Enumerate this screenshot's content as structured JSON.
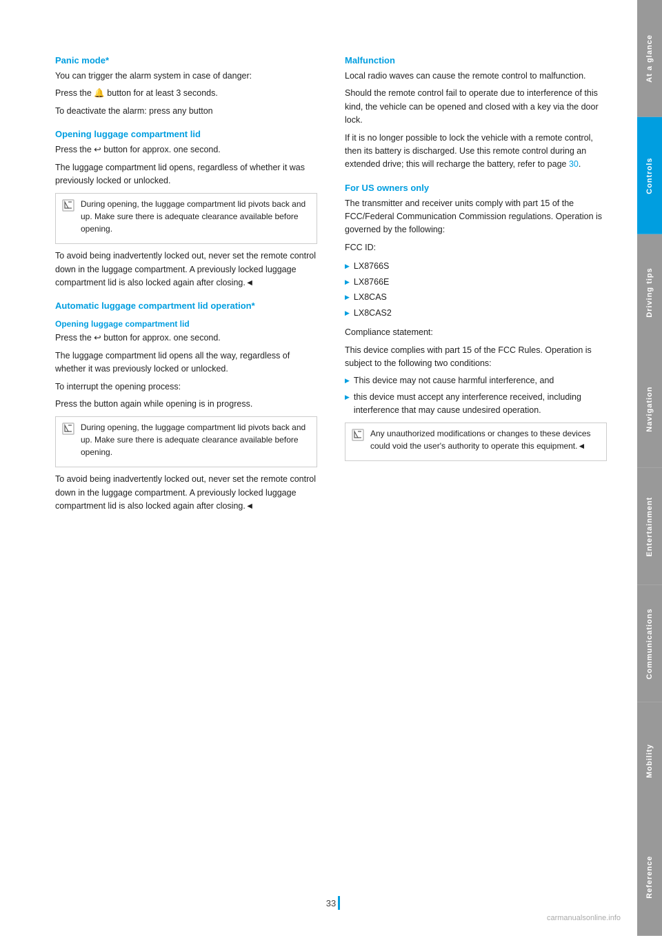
{
  "sidebar": {
    "tabs": [
      {
        "label": "At a glance",
        "key": "at-glance"
      },
      {
        "label": "Controls",
        "key": "controls"
      },
      {
        "label": "Driving tips",
        "key": "driving-tips"
      },
      {
        "label": "Navigation",
        "key": "navigation"
      },
      {
        "label": "Entertainment",
        "key": "entertainment"
      },
      {
        "label": "Communications",
        "key": "communications"
      },
      {
        "label": "Mobility",
        "key": "mobility"
      },
      {
        "label": "Reference",
        "key": "reference"
      }
    ]
  },
  "left_column": {
    "panic_mode": {
      "heading": "Panic mode*",
      "text1": "You can trigger the alarm system in case of danger:",
      "text2": "Press the 🔔 button for at least 3 seconds.",
      "text3": "To deactivate the alarm: press any button"
    },
    "opening_lid": {
      "heading": "Opening luggage compartment lid",
      "text1": "Press the ↩ button for approx. one second.",
      "text2": "The luggage compartment lid opens, regardless of whether it was previously locked or unlocked.",
      "note1": "During opening, the luggage compartment lid pivots back and up. Make sure there is adequate clearance available before opening.",
      "text3": "To avoid being inadvertently locked out, never set the remote control down in the luggage compartment. A previously locked luggage compartment lid is also locked again after closing.◄"
    },
    "auto_lid": {
      "heading": "Automatic luggage compartment lid operation*",
      "sub_heading": "Opening luggage compartment lid",
      "text1": "Press the ↩ button for approx. one second.",
      "text2": "The luggage compartment lid opens all the way, regardless of whether it was previously locked or unlocked.",
      "text3": "To interrupt the opening process:",
      "text4": "Press the button again while opening is in progress.",
      "note1": "During opening, the luggage compartment lid pivots back and up. Make sure there is adequate clearance available before opening.",
      "text5": "To avoid being inadvertently locked out, never set the remote control down in the luggage compartment. A previously locked luggage compartment lid is also locked again after closing.◄"
    }
  },
  "right_column": {
    "malfunction": {
      "heading": "Malfunction",
      "text1": "Local radio waves can cause the remote control to malfunction.",
      "text2": "Should the remote control fail to operate due to interference of this kind, the vehicle can be opened and closed with a key via the door lock.",
      "text3": "If it is no longer possible to lock the vehicle with a remote control, then its battery is discharged. Use this remote control during an extended drive; this will recharge the battery, refer to page 30."
    },
    "for_us_owners": {
      "heading": "For US owners only",
      "text1": "The transmitter and receiver units comply with part 15 of the FCC/Federal Communication Commission regulations. Operation is governed by the following:",
      "fcc_id_label": "FCC ID:",
      "fcc_ids": [
        "LX8766S",
        "LX8766E",
        "LX8CAS",
        "LX8CAS2"
      ],
      "compliance_label": "Compliance statement:",
      "compliance_text": "This device complies with part 15 of the FCC Rules. Operation is subject to the following two conditions:",
      "conditions": [
        "This device may not cause harmful interference, and",
        "this device must accept any interference received, including interference that may cause undesired operation."
      ],
      "note1": "Any unauthorized modifications or changes to these devices could void the user's authority to operate this equipment.◄"
    }
  },
  "page_number": "33",
  "watermark": "carmanualsonline.info"
}
